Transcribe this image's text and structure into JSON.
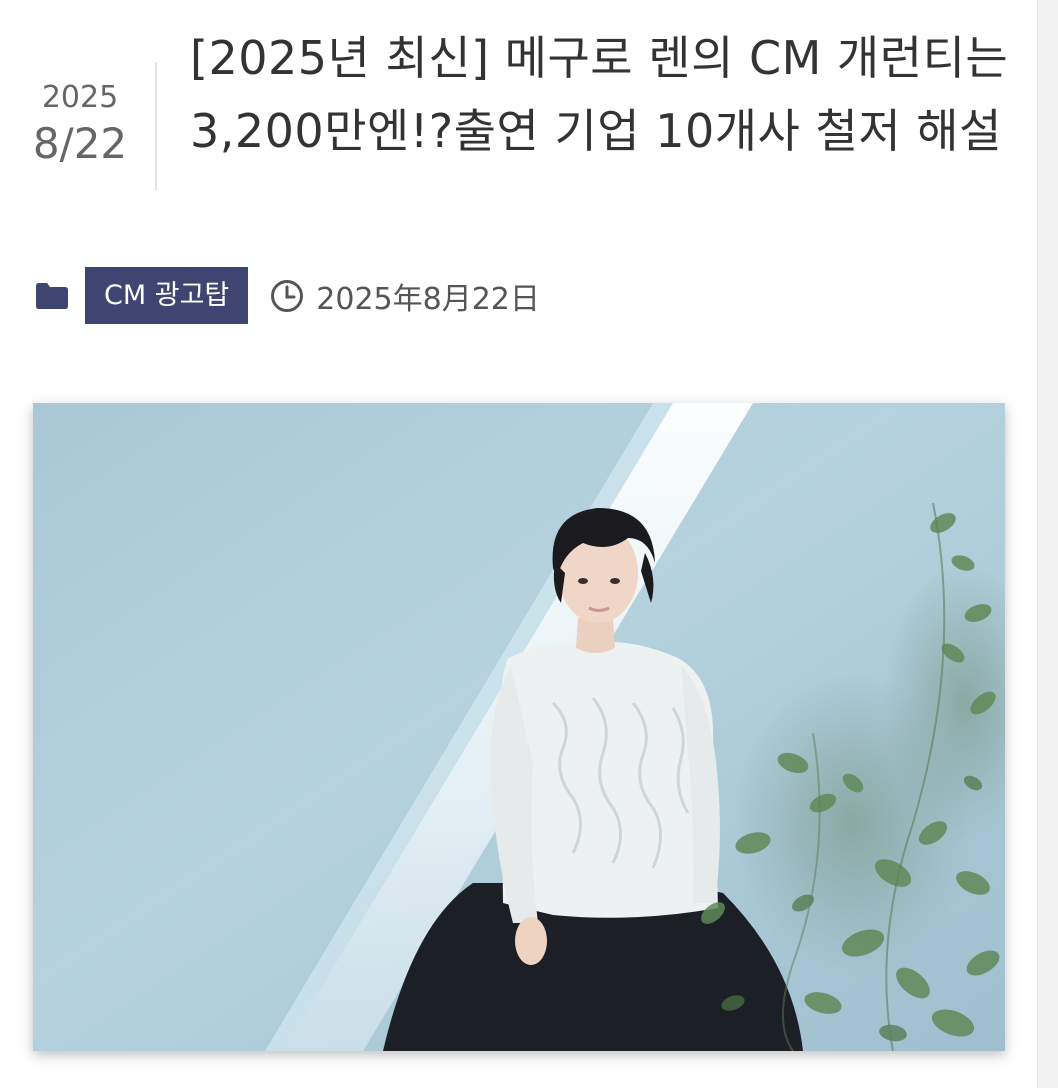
{
  "post": {
    "date_year": "2025",
    "date_month_day": "8/22",
    "title": "[2025년 최신] 메구로 렌의 CM 개런티는 3,200만엔!?출연 기업 10개사 철저 해설",
    "category": "CM 광고탑",
    "published": "2025年8月22日"
  },
  "icons": {
    "category": "folder-icon",
    "published": "clock-icon"
  },
  "colors": {
    "badge_bg": "#3d4570",
    "badge_text": "#ffffff",
    "title_text": "#333333",
    "meta_text": "#555555"
  }
}
